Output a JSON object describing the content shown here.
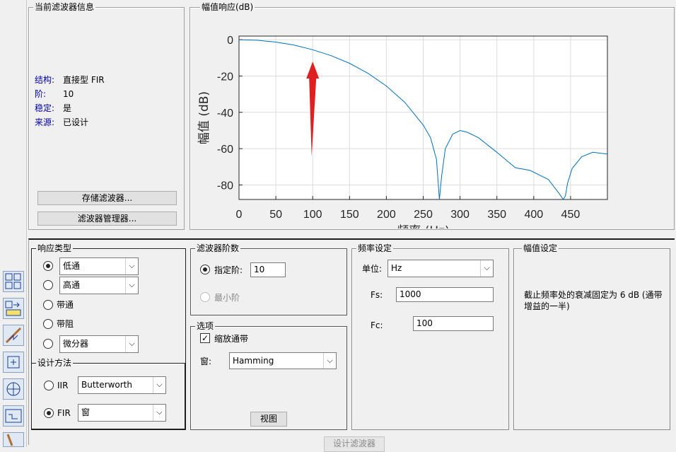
{
  "filter_info": {
    "title": "当前滤波器信息",
    "rows": [
      {
        "label": "结构:",
        "value": "直接型 FIR"
      },
      {
        "label": "阶:",
        "value": "10"
      },
      {
        "label": "稳定:",
        "value": "是"
      },
      {
        "label": "来源:",
        "value": "已设计"
      }
    ],
    "store_button": "存储滤波器...",
    "manager_button": "滤波器管理器..."
  },
  "plot": {
    "title": "幅值响应(dB)",
    "chart_data": {
      "type": "line",
      "xlabel": "频率 (Hz)",
      "ylabel": "幅值 (dB)",
      "xlim": [
        0,
        500
      ],
      "ylim": [
        -88,
        2
      ],
      "xticks": [
        "0",
        "50",
        "100",
        "150",
        "200",
        "250",
        "300",
        "350",
        "400",
        "450"
      ],
      "yticks": [
        "0",
        "-20",
        "-40",
        "-60",
        "-80"
      ],
      "grid": true,
      "series": [
        {
          "color": "#0072bd",
          "x": [
            0,
            25,
            50,
            75,
            100,
            125,
            150,
            175,
            200,
            225,
            250,
            260,
            268,
            272,
            275,
            280,
            290,
            300,
            310,
            325,
            350,
            375,
            395,
            420,
            435,
            440,
            443,
            446,
            452,
            465,
            480,
            500
          ],
          "y": [
            0,
            -0.3,
            -1.3,
            -3,
            -5.5,
            -8.8,
            -13,
            -18.5,
            -25.5,
            -34.5,
            -47,
            -54,
            -66,
            -88,
            -75,
            -60,
            -52,
            -50,
            -51,
            -54,
            -62,
            -70.5,
            -72,
            -77,
            -85,
            -88,
            -86,
            -79,
            -71,
            -64.5,
            -62,
            -63
          ]
        }
      ]
    }
  },
  "response_type": {
    "title": "响应类型",
    "options": [
      {
        "label": "低通",
        "select": true,
        "selected": true
      },
      {
        "label": "高通",
        "select": true,
        "selected": false
      },
      {
        "label": "带通",
        "select": false,
        "selected": false
      },
      {
        "label": "带阻",
        "select": false,
        "selected": false
      },
      {
        "label": "微分器",
        "select": true,
        "selected": false
      }
    ]
  },
  "design_method": {
    "title": "设计方法",
    "iir_label": "IIR",
    "iir_value": "Butterworth",
    "fir_label": "FIR",
    "fir_value": "窗",
    "selected": "FIR"
  },
  "filter_order": {
    "title": "滤波器阶数",
    "specify_label": "指定阶:",
    "specify_value": "10",
    "min_label": "最小阶"
  },
  "options": {
    "title": "选项",
    "scale_label": "缩放通带",
    "scale_checked": true,
    "window_label": "窗:",
    "window_value": "Hamming",
    "view_button": "视图"
  },
  "freq_spec": {
    "title": "频率设定",
    "units_label": "单位:",
    "units_value": "Hz",
    "fs_label": "Fs:",
    "fs_value": "1000",
    "fc_label": "Fc:",
    "fc_value": "100"
  },
  "mag_spec": {
    "title": "幅值设定",
    "text": "截止频率处的衰减固定为 6 dB (通带增益的一半)"
  },
  "design_button": "设计滤波器"
}
